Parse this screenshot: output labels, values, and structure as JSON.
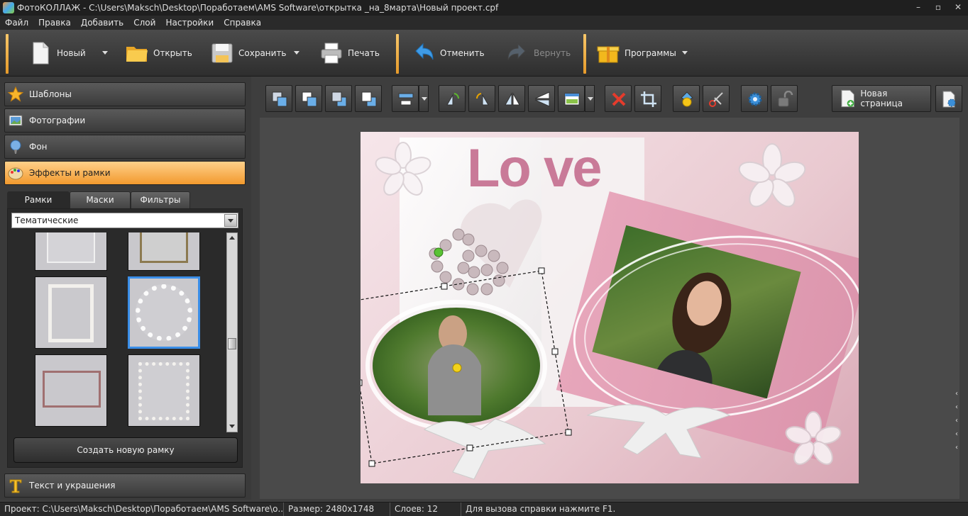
{
  "window": {
    "title": "ФотоКОЛЛАЖ - C:\\Users\\Maksch\\Desktop\\Поработаем\\AMS Software\\открытка _на_8марта\\Новый проект.cpf",
    "minimize": "–",
    "maximize": "▫",
    "close": "✕"
  },
  "menu": [
    "Файл",
    "Правка",
    "Добавить",
    "Слой",
    "Настройки",
    "Справка"
  ],
  "toolbar": {
    "new": "Новый",
    "open": "Открыть",
    "save": "Сохранить",
    "print": "Печать",
    "undo": "Отменить",
    "redo": "Вернуть",
    "programs": "Программы"
  },
  "sidebar": {
    "sections": [
      {
        "label": "Шаблоны",
        "icon": "star-icon"
      },
      {
        "label": "Фотографии",
        "icon": "photos-icon"
      },
      {
        "label": "Фон",
        "icon": "background-icon"
      },
      {
        "label": "Эффекты и рамки",
        "icon": "palette-icon",
        "active": true
      },
      {
        "label": "Текст и украшения",
        "icon": "text-icon"
      }
    ],
    "tabs": [
      "Рамки",
      "Маски",
      "Фильтры"
    ],
    "active_tab": "Рамки",
    "category": "Тематические",
    "create_button": "Создать новую рамку"
  },
  "edit_toolbar": {
    "new_page": "Новая страница"
  },
  "canvas": {
    "title_text": "Lo ve"
  },
  "status": {
    "project_label": "Проект:",
    "project_value": "C:\\Users\\Maksch\\Desktop\\Поработаем\\AMS Software\\о...",
    "size_label": "Размер:",
    "size_value": "2480x1748",
    "layers_label": "Слоев:",
    "layers_value": "12",
    "help": "Для вызова справки нажмите F1."
  },
  "colors": {
    "accent": "#f29a2e",
    "selection": "#3a8ee8",
    "love_text": "#c97a98"
  }
}
